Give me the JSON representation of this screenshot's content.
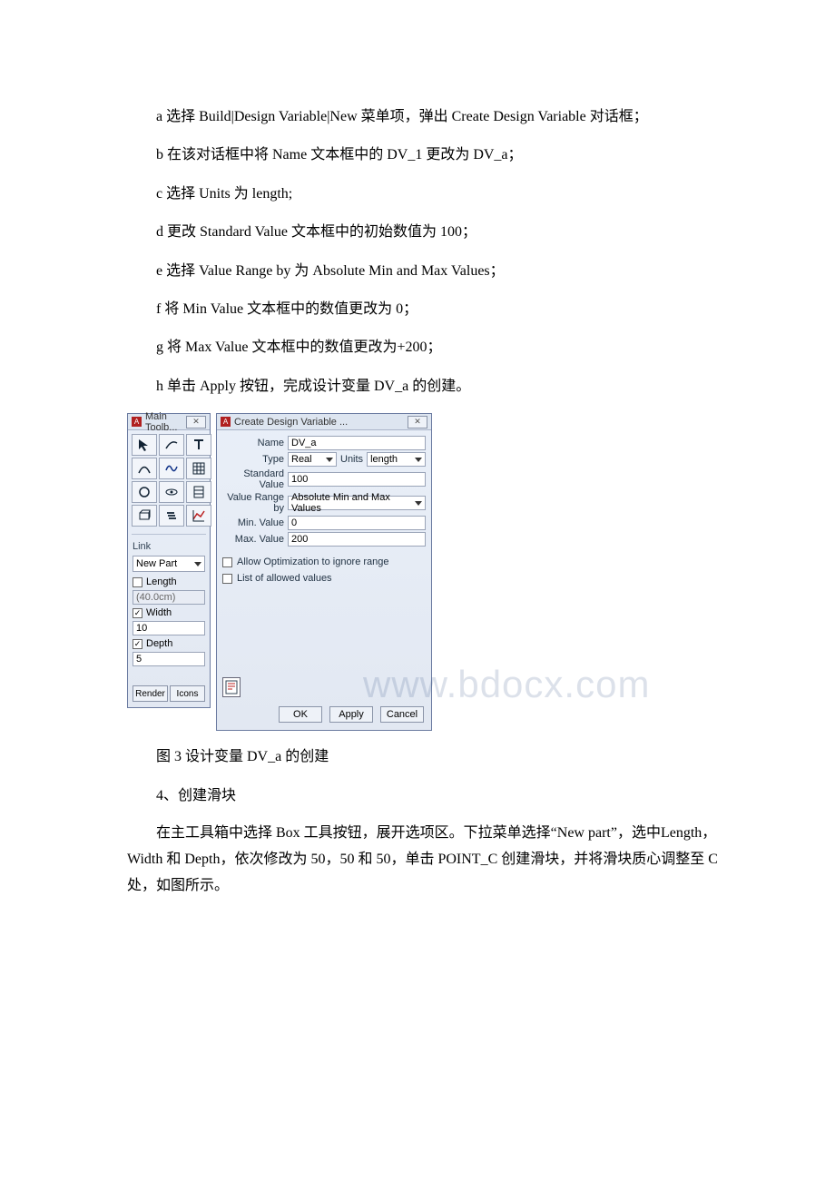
{
  "steps": {
    "a": "a 选择 Build|Design Variable|New 菜单项，弹出 Create Design Variable 对话框；",
    "b": "b 在该对话框中将 Name 文本框中的 DV_1 更改为 DV_a；",
    "c": "c 选择 Units 为 length;",
    "d": "d 更改 Standard Value 文本框中的初始数值为 100；",
    "e": "e 选择 Value Range by 为 Absolute Min and Max Values；",
    "f": "f 将 Min Value 文本框中的数值更改为 0；",
    "g": "g 将 Max Value 文本框中的数值更改为+200；",
    "h": "h 单击 Apply 按钮，完成设计变量 DV_a 的创建。"
  },
  "toolbox": {
    "title": "Main Toolb...",
    "link_label": "Link",
    "new_part": "New Part",
    "length_label": "Length",
    "length_value": "(40.0cm)",
    "width_label": "Width",
    "width_value": "10",
    "depth_label": "Depth",
    "depth_value": "5",
    "render_btn": "Render",
    "icons_btn": "Icons"
  },
  "dialog": {
    "title": "Create Design Variable ...",
    "name_label": "Name",
    "name_value": "DV_a",
    "type_label": "Type",
    "type_value": "Real",
    "units_label": "Units",
    "units_value": "length",
    "std_label": "Standard Value",
    "std_value": "100",
    "range_label": "Value Range by",
    "range_value": "Absolute Min and Max Values",
    "min_label": "Min. Value",
    "min_value": "0",
    "max_label": "Max. Value",
    "max_value": "200",
    "opt_chk": "Allow Optimization to ignore range",
    "list_chk": "List of allowed values",
    "ok": "OK",
    "apply": "Apply",
    "cancel": "Cancel"
  },
  "watermark": "www.bdocx.com",
  "caption": "图 3 设计变量 DV_a 的创建",
  "section4_title": "4、创建滑块",
  "section4_body": "在主工具箱中选择 Box 工具按钮，展开选项区。下拉菜单选择“New part”，选中Length， Width 和 Depth，依次修改为 50，50 和 50，单击 POINT_C 创建滑块，并将滑块质心调整至 C 处，如图所示。"
}
